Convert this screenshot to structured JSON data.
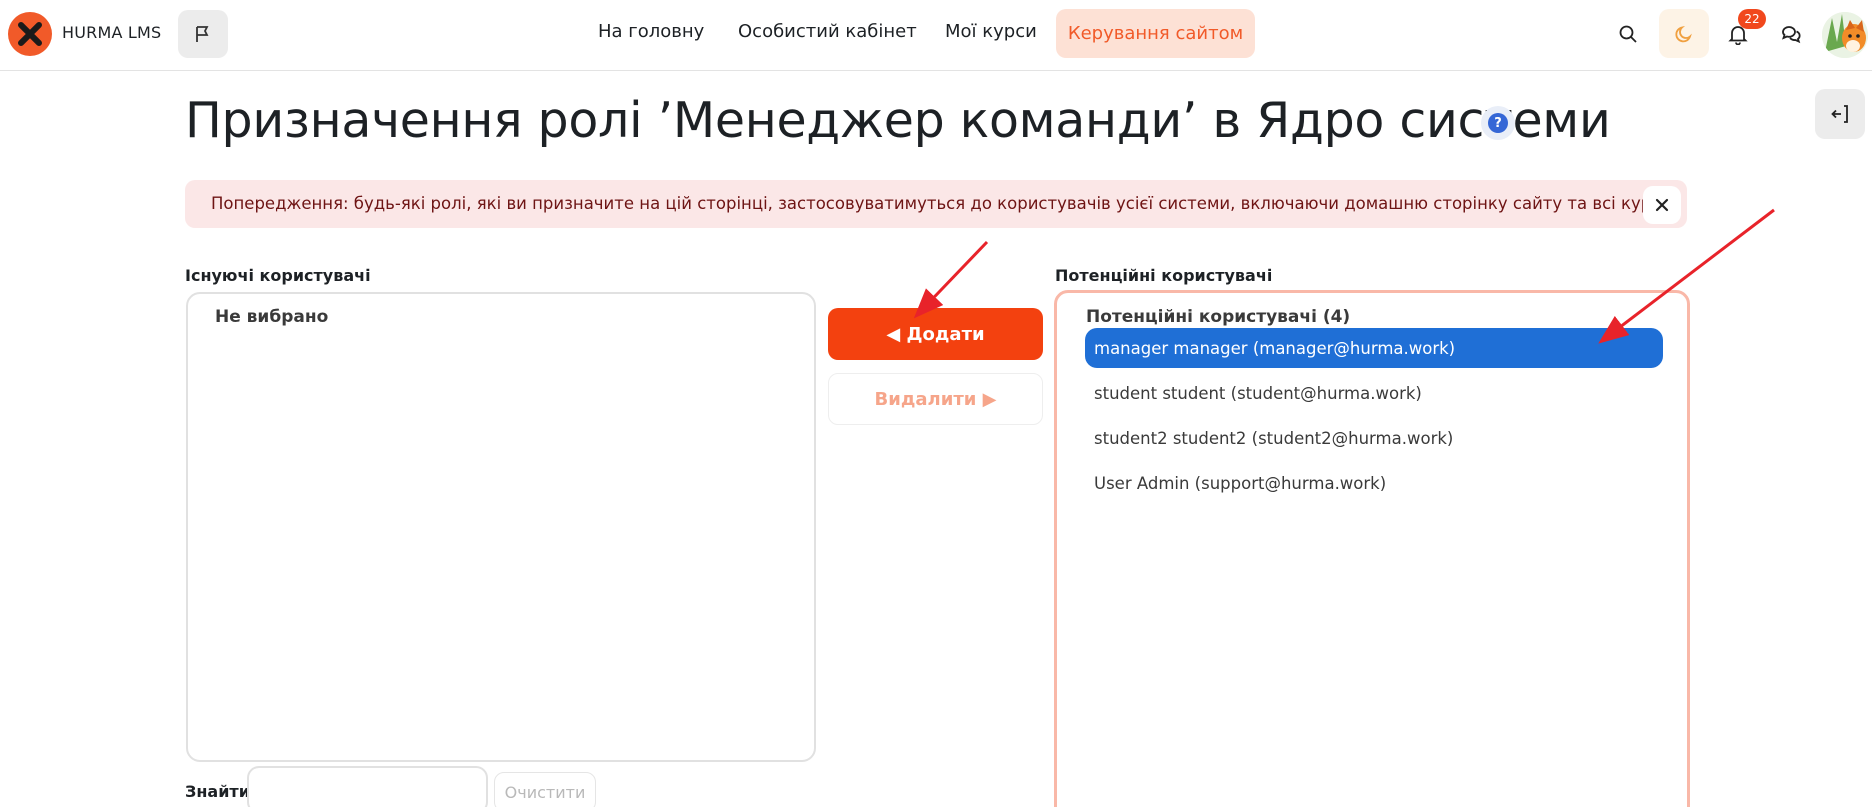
{
  "navbar": {
    "brand": "HURMA LMS",
    "links": [
      "На головну",
      "Особистий кабінет",
      "Мої курси"
    ],
    "active_link": "Керування сайтом",
    "notification_count": "22",
    "accent_color": "#f15a29"
  },
  "page": {
    "title": "Призначення ролі ’Менеджер команди’ в Ядро системи",
    "help_icon": "?"
  },
  "warning": {
    "text": "Попередження: будь-які ролі, які ви призначите на цій сторінці, застосовуватимуться до користувачів усієї системи, включаючи домашню сторінку сайту та всі курси."
  },
  "existing": {
    "label": "Існуючі користувачі",
    "empty_text": "Не вибрано",
    "find_label": "Знайти",
    "find_value": "",
    "clear_label": "Очистити"
  },
  "actions": {
    "add_label": "◀ Додати",
    "remove_label": "Видалити ▶"
  },
  "potential": {
    "label": "Потенційні користувачі",
    "group_label": "Потенційні користувачі (4)",
    "options": [
      {
        "text": "manager manager (manager@hurma.work)",
        "selected": true
      },
      {
        "text": "student student (student@hurma.work)",
        "selected": false
      },
      {
        "text": "student2 student2 (student2@hurma.work)",
        "selected": false
      },
      {
        "text": "User Admin (support@hurma.work)",
        "selected": false
      }
    ]
  },
  "colors": {
    "primary_button": "#f3410f",
    "selected_option": "#1f6fd6",
    "annotation_arrow": "#e8232a"
  }
}
